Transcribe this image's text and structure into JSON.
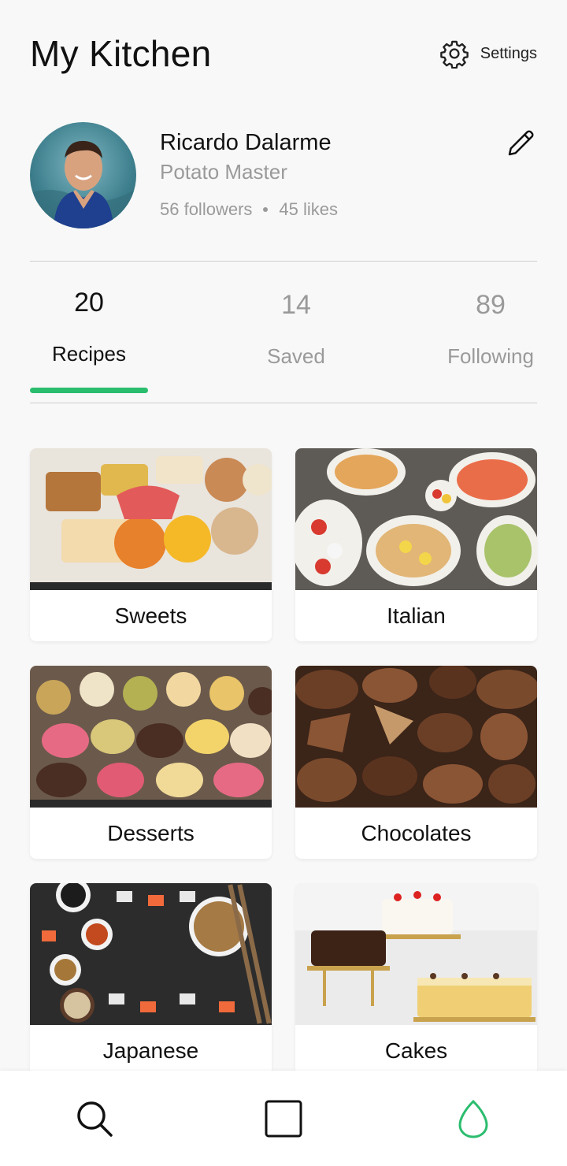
{
  "header": {
    "title": "My Kitchen",
    "settings_label": "Settings"
  },
  "profile": {
    "name": "Ricardo Dalarme",
    "title": "Potato Master",
    "followers": "56 followers",
    "likes": "45 likes"
  },
  "tabs": [
    {
      "count": "20",
      "label": "Recipes",
      "active": true
    },
    {
      "count": "14",
      "label": "Saved",
      "active": false
    },
    {
      "count": "89",
      "label": "Following",
      "active": false
    }
  ],
  "categories": [
    {
      "label": "Sweets"
    },
    {
      "label": "Italian"
    },
    {
      "label": "Desserts"
    },
    {
      "label": "Chocolates"
    },
    {
      "label": "Japanese"
    },
    {
      "label": "Cakes"
    }
  ],
  "bottom_nav": [
    {
      "icon": "search-icon"
    },
    {
      "icon": "square-icon"
    },
    {
      "icon": "egg-icon"
    }
  ],
  "colors": {
    "accent": "#2bbd6e",
    "muted_text": "#9a9a9a",
    "background": "#f8f8f8"
  }
}
